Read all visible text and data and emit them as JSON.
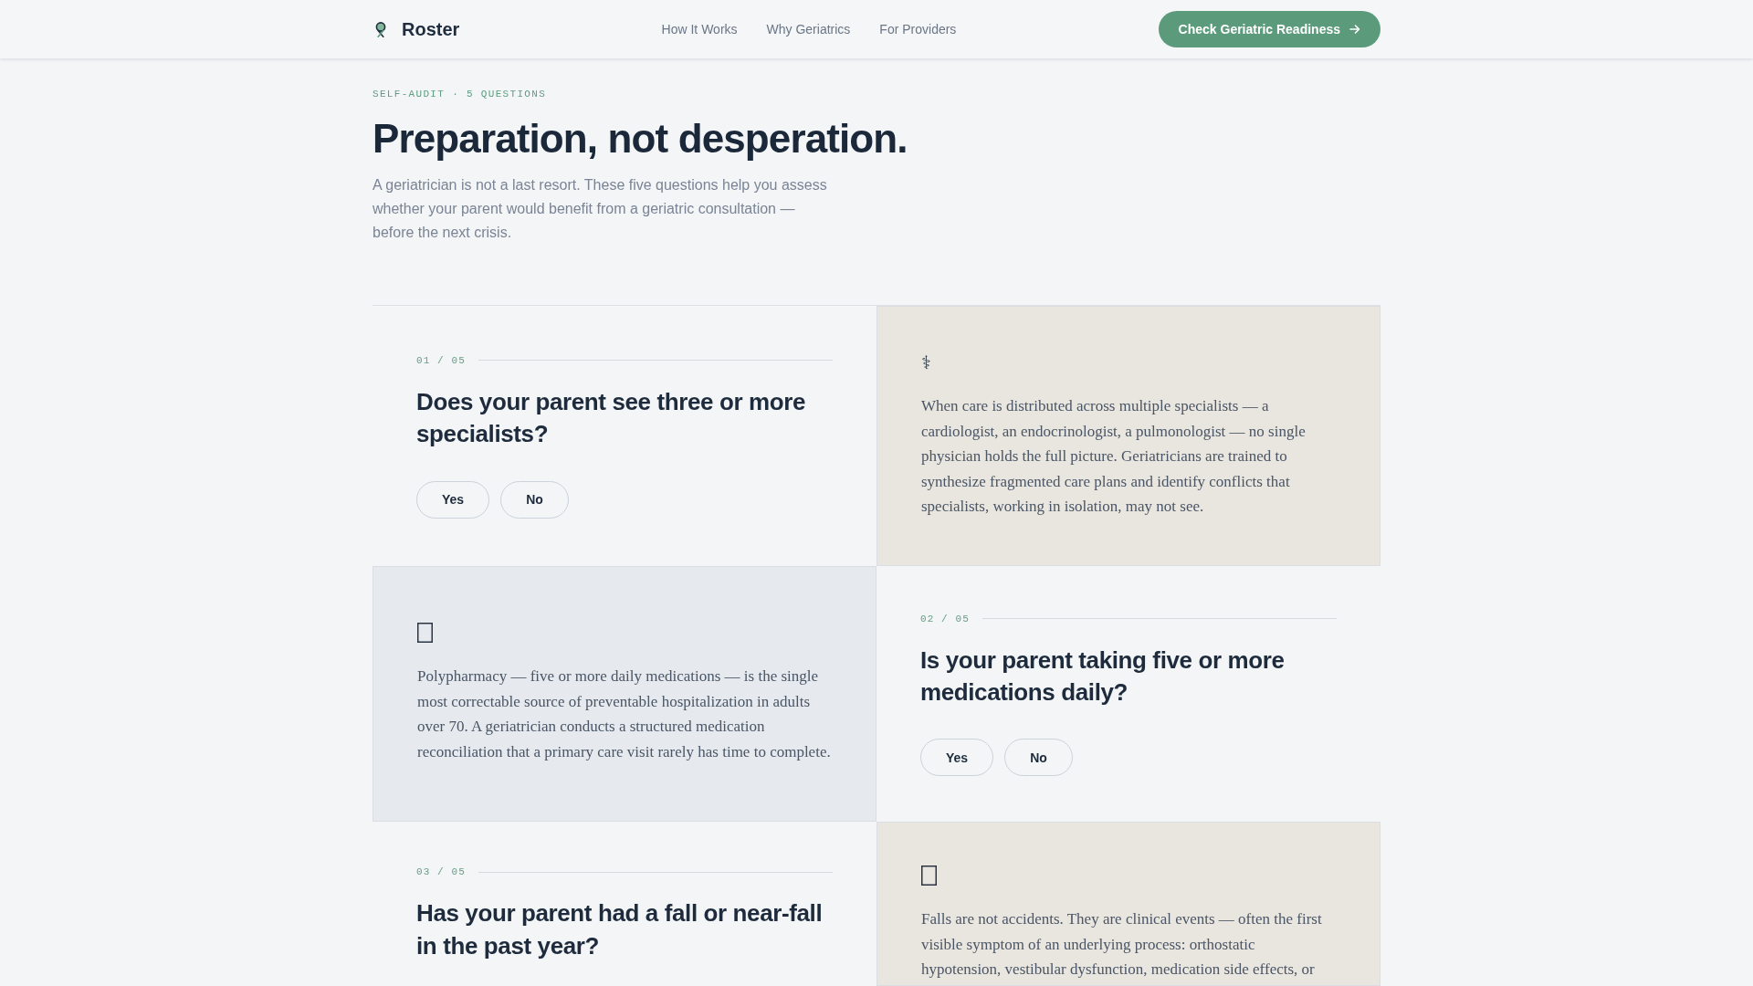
{
  "header": {
    "logo": "Roster",
    "nav": [
      {
        "label": "How It Works"
      },
      {
        "label": "Why Geriatrics"
      },
      {
        "label": "For Providers"
      }
    ],
    "cta": {
      "label": "Check Geriatric Readiness"
    }
  },
  "intro": {
    "eyebrow": "SELF-AUDIT · 5 QUESTIONS",
    "title": "Preparation, not desperation.",
    "lead": "A geriatrician is not a last resort. These five questions help you assess whether your parent would benefit from a geriatric consultation — before the next crisis."
  },
  "questions": [
    {
      "number": "01 / 05",
      "question": "Does your parent see three or more specialists?",
      "answers": [
        {
          "label": "Yes",
          "selected": false
        },
        {
          "label": "No",
          "selected": false
        }
      ],
      "insight": {
        "icon": {
          "kind": "glyph",
          "symbol": "⚕"
        },
        "text": "When care is distributed across multiple specialists — a cardiologist, an endocrinologist, a pulmonologist — no single physician holds the full picture. Geriatricians are trained to synthesize fragmented care plans and identify conflicts that specialists, working in isolation, may not see."
      }
    },
    {
      "number": "02 / 05",
      "question": "Is your parent taking five or more medications daily?",
      "answers": [
        {
          "label": "Yes",
          "selected": false
        },
        {
          "label": "No",
          "selected": false
        }
      ],
      "insight": {
        "icon": {
          "kind": "missing-glyph"
        },
        "text": "Polypharmacy — five or more daily medications — is the single most correctable source of preventable hospitalization in adults over 70. A geriatrician conducts a structured medication reconciliation that a primary care visit rarely has time to complete."
      }
    },
    {
      "number": "03 / 05",
      "question": "Has your parent had a fall or near-fall in the past year?",
      "insight": {
        "icon": {
          "kind": "missing-glyph"
        },
        "text": "Falls are not accidents. They are clinical events — often the first visible symptom of an underlying process: orthostatic hypotension, vestibular dysfunction, medication side effects, or"
      }
    }
  ]
}
